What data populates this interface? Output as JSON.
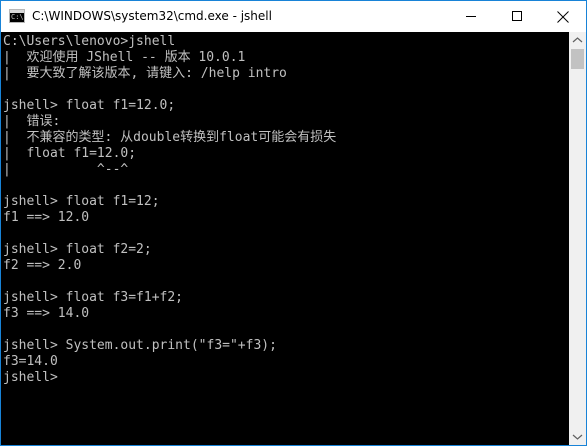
{
  "window": {
    "title": "C:\\WINDOWS\\system32\\cmd.exe - jshell",
    "icon": "cmd-app-icon",
    "icon_glyph": "C:\\",
    "controls": [
      "minimize-icon",
      "maximize-icon",
      "close-icon"
    ]
  },
  "console": {
    "lines": [
      "C:\\Users\\lenovo>jshell",
      "|  欢迎使用 JShell -- 版本 10.0.1",
      "|  要大致了解该版本, 请键入: /help intro",
      "",
      "jshell> float f1=12.0;",
      "|  错误:",
      "|  不兼容的类型: 从double转换到float可能会有损失",
      "|  float f1=12.0;",
      "|           ^--^",
      "",
      "jshell> float f1=12;",
      "f1 ==> 12.0",
      "",
      "jshell> float f2=2;",
      "f2 ==> 2.0",
      "",
      "jshell> float f3=f1+f2;",
      "f3 ==> 14.0",
      "",
      "jshell> System.out.print(\"f3=\"+f3);",
      "f3=14.0",
      "jshell>"
    ]
  },
  "colors": {
    "console_bg": "#000000",
    "console_fg": "#c0c0c0",
    "window_border": "#1883d7",
    "titlebar_bg": "#ffffff"
  }
}
